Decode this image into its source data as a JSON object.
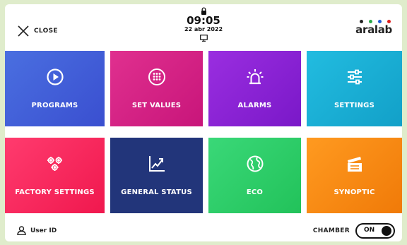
{
  "header": {
    "close_label": "CLOSE",
    "time": "09:05",
    "date": "22 abr 2022",
    "brand_name": "aralab",
    "brand_dot_colors": [
      "#222222",
      "#2aa84a",
      "#1e5bd8",
      "#e02020"
    ]
  },
  "tiles": [
    {
      "label": "PROGRAMS",
      "icon": "play-circle-icon",
      "color": "#3f5fd8"
    },
    {
      "label": "SET VALUES",
      "icon": "keypad-icon",
      "color": "#d4208a"
    },
    {
      "label": "ALARMS",
      "icon": "alarm-light-icon",
      "color": "#8a24d8"
    },
    {
      "label": "SETTINGS",
      "icon": "sliders-icon",
      "color": "#1ab0d8"
    },
    {
      "label": "FACTORY SETTINGS",
      "icon": "gears-icon",
      "color": "#f8285c"
    },
    {
      "label": "GENERAL STATUS",
      "icon": "trend-chart-icon",
      "color": "#22357a"
    },
    {
      "label": "ECO",
      "icon": "globe-icon",
      "color": "#2ecc6a"
    },
    {
      "label": "SYNOPTIC",
      "icon": "clapperboard-icon",
      "color": "#f88a12"
    }
  ],
  "footer": {
    "user_label": "User ID",
    "chamber_label": "CHAMBER",
    "chamber_toggle_text": "ON",
    "chamber_on": true
  }
}
